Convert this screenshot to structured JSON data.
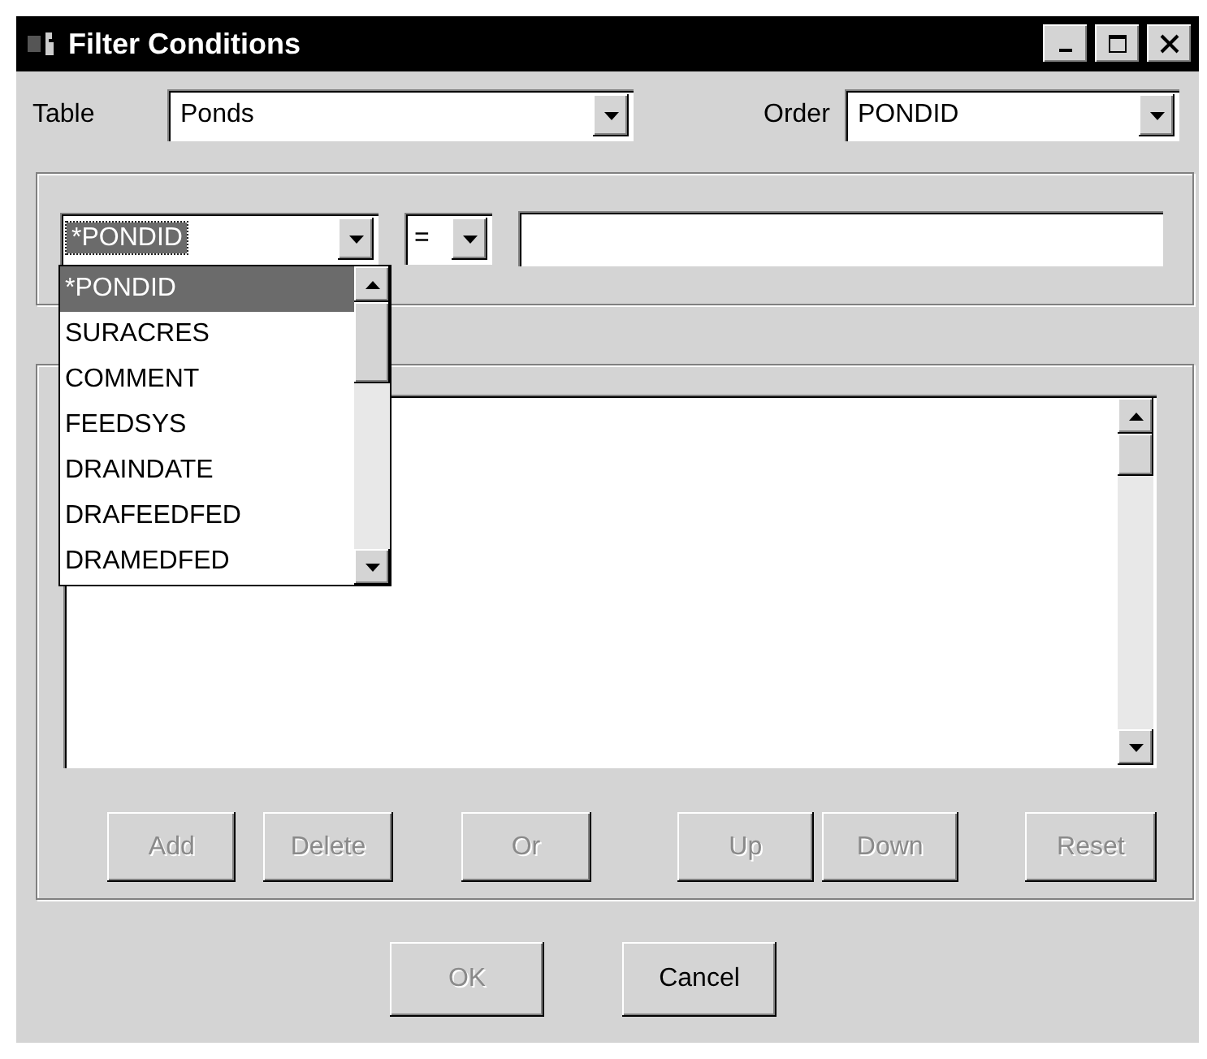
{
  "window": {
    "title": "Filter Conditions"
  },
  "table": {
    "label": "Table",
    "value": "Ponds"
  },
  "order": {
    "label": "Order",
    "value": "PONDID"
  },
  "condition": {
    "field": {
      "value": "*PONDID",
      "expanded": true,
      "options": [
        {
          "label": "*PONDID",
          "selected": true
        },
        {
          "label": "SURACRES",
          "selected": false
        },
        {
          "label": "COMMENT",
          "selected": false
        },
        {
          "label": "FEEDSYS",
          "selected": false
        },
        {
          "label": "DRAINDATE",
          "selected": false
        },
        {
          "label": "DRAFEEDFED",
          "selected": false
        },
        {
          "label": "DRAMEDFED",
          "selected": false
        }
      ]
    },
    "operator": {
      "value": "="
    }
  },
  "buttons": [
    {
      "label": "Add",
      "disabled": true
    },
    {
      "label": "Delete",
      "disabled": true
    },
    {
      "label": "Or",
      "disabled": true
    },
    {
      "label": "Up",
      "disabled": true
    },
    {
      "label": "Down",
      "disabled": true
    },
    {
      "label": "Reset",
      "disabled": true
    }
  ],
  "dialog_buttons": [
    {
      "label": "OK",
      "disabled": true
    },
    {
      "label": "Cancel",
      "disabled": false
    }
  ]
}
